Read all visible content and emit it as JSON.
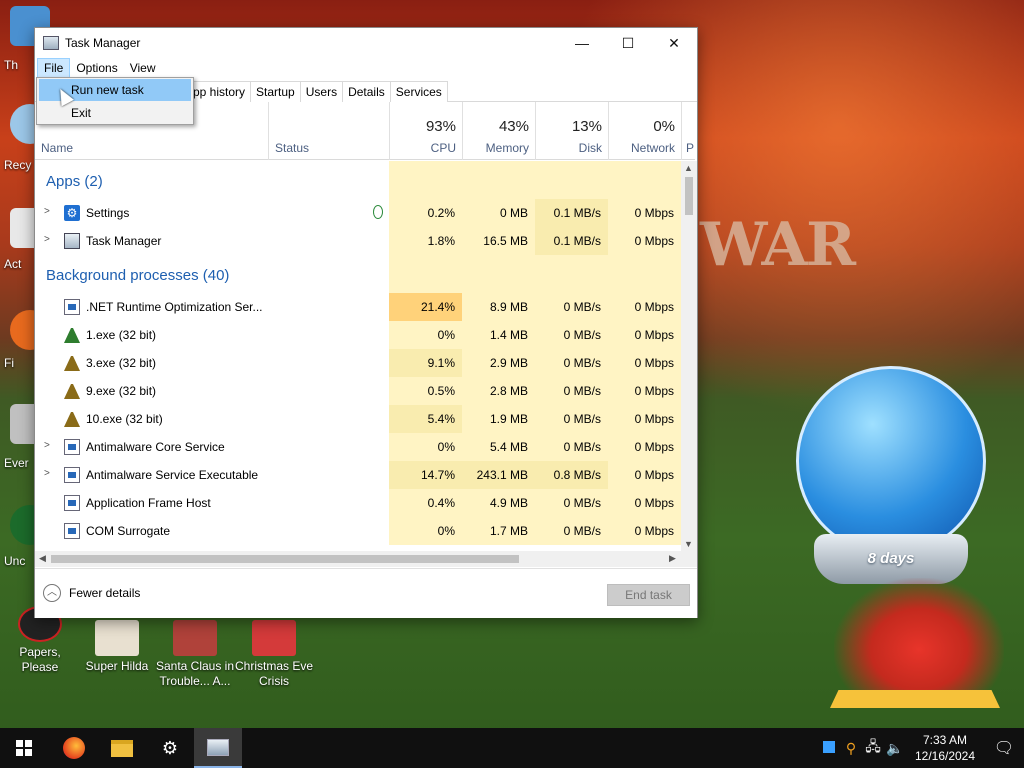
{
  "desktop": {
    "left_labels": [
      "Th",
      "Recy",
      "Act",
      "Fi",
      "Ever",
      "Unc"
    ],
    "bottom_icons": [
      {
        "label": "Papers, Please"
      },
      {
        "label": "Super Hilda"
      },
      {
        "label": "Santa Claus in Trouble... A..."
      },
      {
        "label": "Christmas Eve Crisis"
      }
    ],
    "globe_text": "8 days"
  },
  "window": {
    "title": "Task Manager",
    "controls": {
      "minimize": "—",
      "maximize": "☐",
      "close": "✕"
    }
  },
  "menu": {
    "file": "File",
    "options": "Options",
    "view": "View",
    "file_items": [
      "Run new task",
      "Exit"
    ]
  },
  "tabs": [
    "pp history",
    "Startup",
    "Users",
    "Details",
    "Services"
  ],
  "columns": {
    "name": "Name",
    "status": "Status",
    "cpu": {
      "pct": "93%",
      "label": "CPU"
    },
    "memory": {
      "pct": "43%",
      "label": "Memory"
    },
    "disk": {
      "pct": "13%",
      "label": "Disk"
    },
    "network": {
      "pct": "0%",
      "label": "Network"
    },
    "power": "P"
  },
  "groups": {
    "apps": "Apps (2)",
    "background": "Background processes (40)"
  },
  "apps": [
    {
      "name": "Settings",
      "cpu": "0.2%",
      "mem": "0 MB",
      "disk": "0.1 MB/s",
      "net": "0 Mbps"
    },
    {
      "name": "Task Manager",
      "cpu": "1.8%",
      "mem": "16.5 MB",
      "disk": "0.1 MB/s",
      "net": "0 Mbps"
    }
  ],
  "processes": [
    {
      "name": ".NET Runtime Optimization Ser...",
      "cpu": "21.4%",
      "mem": "8.9 MB",
      "disk": "0 MB/s",
      "net": "0 Mbps"
    },
    {
      "name": "1.exe (32 bit)",
      "cpu": "0%",
      "mem": "1.4 MB",
      "disk": "0 MB/s",
      "net": "0 Mbps"
    },
    {
      "name": "3.exe (32 bit)",
      "cpu": "9.1%",
      "mem": "2.9 MB",
      "disk": "0 MB/s",
      "net": "0 Mbps"
    },
    {
      "name": "9.exe (32 bit)",
      "cpu": "0.5%",
      "mem": "2.8 MB",
      "disk": "0 MB/s",
      "net": "0 Mbps"
    },
    {
      "name": "10.exe (32 bit)",
      "cpu": "5.4%",
      "mem": "1.9 MB",
      "disk": "0 MB/s",
      "net": "0 Mbps"
    },
    {
      "name": "Antimalware Core Service",
      "cpu": "0%",
      "mem": "5.4 MB",
      "disk": "0 MB/s",
      "net": "0 Mbps"
    },
    {
      "name": "Antimalware Service Executable",
      "cpu": "14.7%",
      "mem": "243.1 MB",
      "disk": "0.8 MB/s",
      "net": "0 Mbps"
    },
    {
      "name": "Application Frame Host",
      "cpu": "0.4%",
      "mem": "4.9 MB",
      "disk": "0 MB/s",
      "net": "0 Mbps"
    },
    {
      "name": "COM Surrogate",
      "cpu": "0%",
      "mem": "1.7 MB",
      "disk": "0 MB/s",
      "net": "0 Mbps"
    }
  ],
  "footer": {
    "fewer_details": "Fewer details",
    "end_task": "End task"
  },
  "taskbar": {
    "time": "7:33 AM",
    "date": "12/16/2024"
  }
}
